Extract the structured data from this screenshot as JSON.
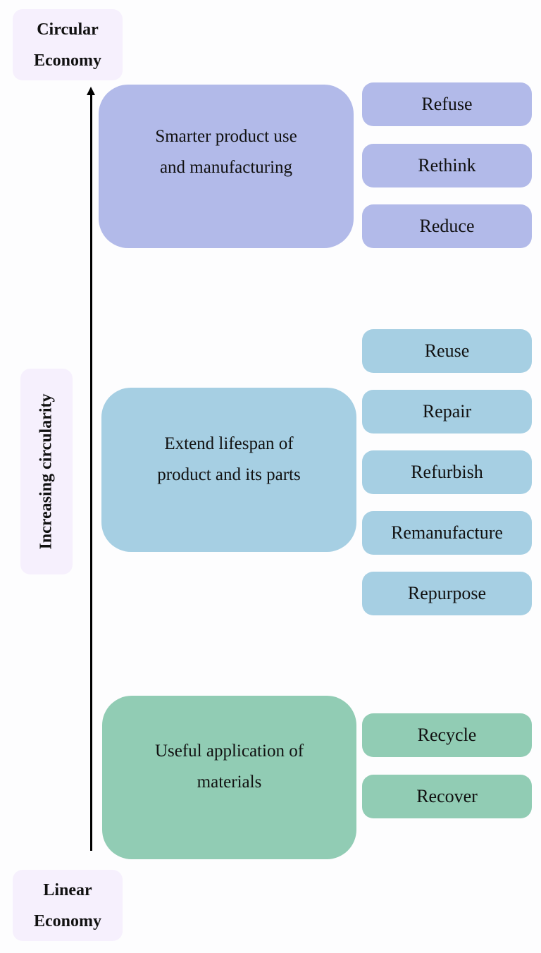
{
  "labels": {
    "top": "Circular Economy",
    "top_lines": [
      "Circular",
      "Economy"
    ],
    "bottom_lines": [
      "Linear",
      "Economy"
    ],
    "axis": "Increasing circularity"
  },
  "colors": {
    "smarter": "#b2bae9",
    "extend": "#a6cfe3",
    "useful": "#91ccb4",
    "label_bg": "#f6f0fd"
  },
  "groups": [
    {
      "title_lines": [
        "Smarter product use",
        "and manufacturing"
      ],
      "items": [
        "Refuse",
        "Rethink",
        "Reduce"
      ]
    },
    {
      "title_lines": [
        "Extend lifespan of",
        "product and its parts"
      ],
      "items": [
        "Reuse",
        "Repair",
        "Refurbish",
        "Remanufacture",
        "Repurpose"
      ]
    },
    {
      "title_lines": [
        "Useful application of",
        "materials"
      ],
      "items": [
        "Recycle",
        "Recover"
      ]
    }
  ]
}
